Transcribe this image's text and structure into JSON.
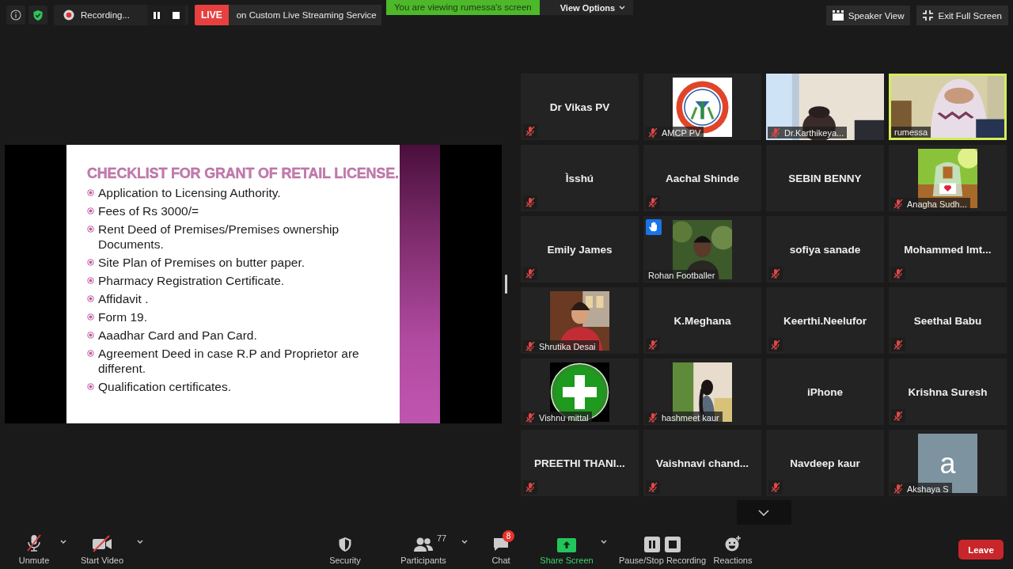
{
  "top_bar": {
    "recording": "Recording...",
    "live_badge": "LIVE",
    "live_service": "on Custom Live Streaming Service",
    "banner": "You are viewing rumessa's screen",
    "view_options": "View Options",
    "speaker_view": "Speaker View",
    "exit_full_screen": "Exit Full Screen"
  },
  "slide": {
    "title": "CHECKLIST FOR GRANT OF RETAIL LICENSE.",
    "bullets": [
      "Application to Licensing Authority.",
      "Fees of Rs 3000/=",
      "Rent Deed of Premises/Premises ownership Documents.",
      "Site Plan of Premises on butter paper.",
      "Pharmacy Registration Certificate.",
      "Affidavit .",
      "Form 19.",
      "Aaadhar Card and Pan Card.",
      "Agreement Deed in case R.P and Proprietor are different.",
      "Qualification certificates."
    ]
  },
  "tiles": [
    {
      "name": "Dr Vikas PV",
      "kind": "name",
      "muted": true,
      "hand_raised": false,
      "speaking": false
    },
    {
      "name": "AMCP PV",
      "muted": true,
      "hand_raised": false,
      "speaking": false
    },
    {
      "name": "Dr.Karthikeya...",
      "kind": "video",
      "muted": true,
      "hand_raised": false,
      "speaking": false
    },
    {
      "name": "rumessa",
      "kind": "video",
      "muted": false,
      "hand_raised": false,
      "speaking": true
    },
    {
      "name": "Ìsshú",
      "kind": "name",
      "muted": true,
      "hand_raised": false,
      "speaking": false
    },
    {
      "name": "Aachal Shinde",
      "kind": "name",
      "muted": true,
      "hand_raised": false,
      "speaking": false
    },
    {
      "name": "SEBIN BENNY",
      "kind": "name",
      "muted": false,
      "hand_raised": false,
      "speaking": false
    },
    {
      "name": "Anagha Sudh...",
      "muted": true,
      "hand_raised": false,
      "speaking": false
    },
    {
      "name": "Emily James",
      "kind": "name",
      "muted": true,
      "hand_raised": false,
      "speaking": false
    },
    {
      "name": "Rohan Footballer",
      "muted": false,
      "hand_raised": true,
      "speaking": false
    },
    {
      "name": "sofiya sanade",
      "kind": "name",
      "muted": true,
      "hand_raised": false,
      "speaking": false
    },
    {
      "name": "Mohammed Imt...",
      "kind": "name",
      "muted": true,
      "hand_raised": false,
      "speaking": false
    },
    {
      "name": "Shrutika Desai",
      "muted": true,
      "hand_raised": false,
      "speaking": false
    },
    {
      "name": "K.Meghana",
      "kind": "name",
      "muted": true,
      "hand_raised": false,
      "speaking": false
    },
    {
      "name": "Keerthi.Neelufor",
      "kind": "name",
      "muted": true,
      "hand_raised": false,
      "speaking": false
    },
    {
      "name": "Seethal Babu",
      "kind": "name",
      "muted": true,
      "hand_raised": false,
      "speaking": false
    },
    {
      "name": "Vishnu mittal",
      "kind": "icon",
      "muted": true,
      "hand_raised": false,
      "speaking": false
    },
    {
      "name": "hashmeet kaur",
      "muted": true,
      "hand_raised": false,
      "speaking": false
    },
    {
      "name": "iPhone",
      "kind": "name",
      "muted": false,
      "hand_raised": false,
      "speaking": false
    },
    {
      "name": "Krishna Suresh",
      "kind": "name",
      "muted": true,
      "hand_raised": false,
      "speaking": false
    },
    {
      "name": "PREETHI THANI...",
      "kind": "name",
      "muted": true,
      "hand_raised": false,
      "speaking": false
    },
    {
      "name": "Vaishnavi chand...",
      "kind": "name",
      "muted": true,
      "hand_raised": false,
      "speaking": false
    },
    {
      "name": "Navdeep kaur",
      "kind": "name",
      "muted": true,
      "hand_raised": false,
      "speaking": false
    },
    {
      "name": "Akshaya S",
      "kind": "avatar",
      "letter": "a",
      "muted": true,
      "hand_raised": false,
      "speaking": false
    }
  ],
  "toolbar": {
    "items": [
      {
        "kind": "unmute",
        "label": "Unmute",
        "caret": true
      },
      {
        "kind": "video",
        "label": "Start Video",
        "caret": true
      },
      {
        "kind": "security",
        "label": "Security",
        "caret": false
      },
      {
        "kind": "participants",
        "label": "Participants",
        "count": "77",
        "caret": true
      },
      {
        "kind": "chat",
        "label": "Chat",
        "badge": "8",
        "caret": false
      },
      {
        "kind": "share",
        "label": "Share Screen",
        "caret": true
      },
      {
        "kind": "record",
        "label": "Pause/Stop Recording",
        "caret": false
      },
      {
        "kind": "reactions",
        "label": "Reactions",
        "caret": false
      }
    ],
    "leave": "Leave"
  }
}
